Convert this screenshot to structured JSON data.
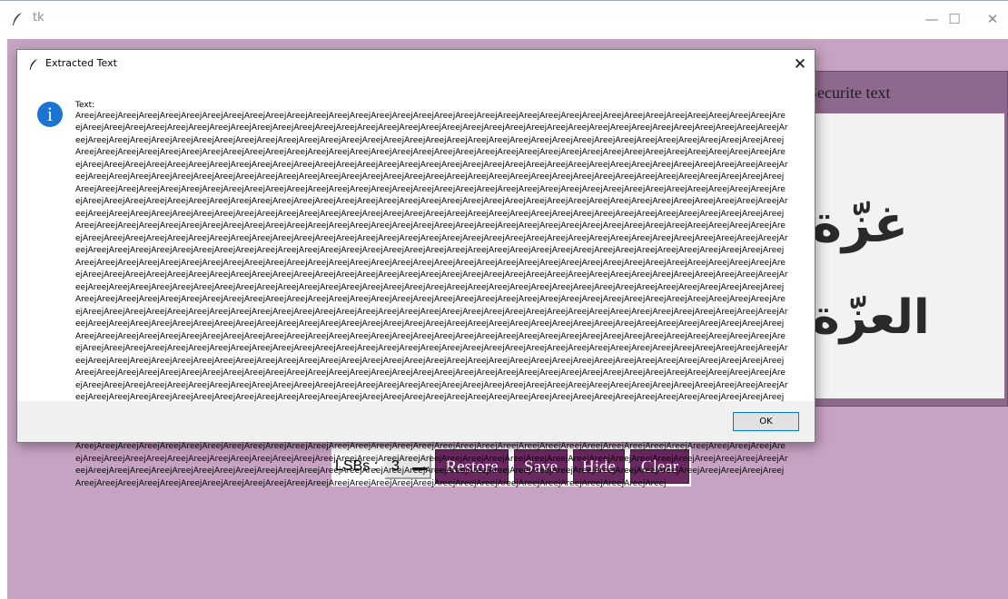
{
  "main_window": {
    "title": "tk",
    "controls": {
      "minimize": "—",
      "maximize": "☐",
      "close": "✕"
    }
  },
  "panel": {
    "title": "Securite text",
    "image_text_line1": "غزّة",
    "image_text_line2": "العزّة"
  },
  "controls": {
    "lsb_label": "LSBs :",
    "lsb_value": "3",
    "restore_label": "Restore",
    "save_label": "Save",
    "hide_label": "Hide",
    "clear_label": "Clear"
  },
  "dialog": {
    "title": "Extracted Text",
    "close": "✕",
    "message_label": "Text:",
    "ok_label": "OK",
    "message_unit": "Areej",
    "message_repeat_count": 1038
  },
  "colors": {
    "background": "#c6a3c2",
    "panel": "#8d6a8d",
    "button": "#6b2961",
    "info_icon": "#1a74d2",
    "ok_border": "#0078d7"
  }
}
